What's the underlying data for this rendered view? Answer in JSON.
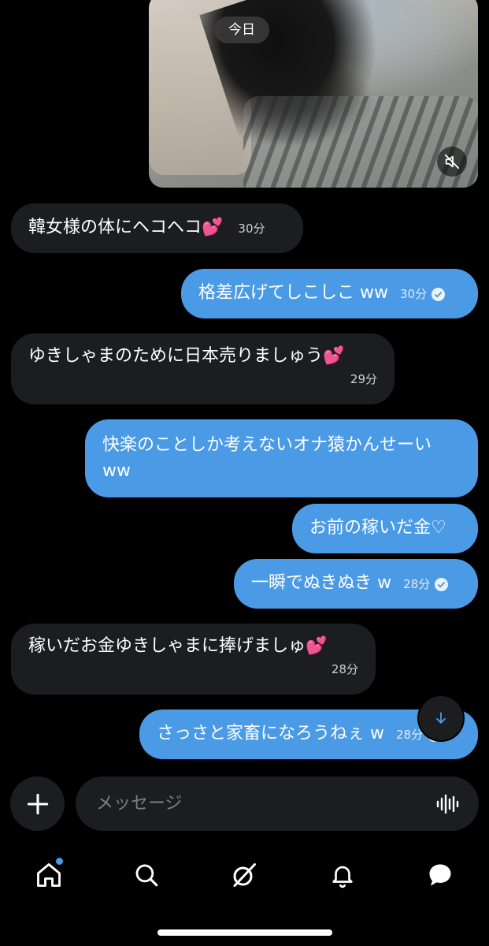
{
  "chat": {
    "date_chip": "今日",
    "messages": [
      {
        "side": "in",
        "text": "韓女様の体にヘコヘコ💕",
        "time": "30分"
      },
      {
        "side": "out",
        "text": "格差広げてしこしこ ww",
        "time": "30分",
        "read": true
      },
      {
        "side": "in",
        "text": "ゆきしゃまのために日本売りましゅう💕",
        "time": "29分"
      },
      {
        "side": "out",
        "text_line1": "快楽のことしか考えないオナ猿かんせーい",
        "text_line2": "ww"
      },
      {
        "side": "out",
        "text": "お前の稼いだ金♡"
      },
      {
        "side": "out",
        "text": "一瞬でぬきぬき w",
        "time": "28分",
        "read": true
      },
      {
        "side": "in",
        "text": "稼いだお金ゆきしゃまに捧げましゅ💕",
        "time": "28分"
      },
      {
        "side": "out",
        "text": "さっさと家畜になろうねぇ w",
        "time": "28分",
        "read": true
      }
    ]
  },
  "composer": {
    "placeholder": "メッセージ"
  },
  "icons": {
    "mute": "speaker-muted-icon",
    "scroll_down": "arrow-down-icon",
    "add": "plus-icon",
    "voice": "voice-waveform-icon",
    "tabs": [
      "home-icon",
      "search-icon",
      "grok-icon",
      "bell-icon",
      "messages-icon"
    ]
  },
  "colors": {
    "background": "#000000",
    "outgoing_bubble": "#4a9ae6",
    "incoming_bubble": "#1c1d1f",
    "accent": "#4a9ae6"
  }
}
